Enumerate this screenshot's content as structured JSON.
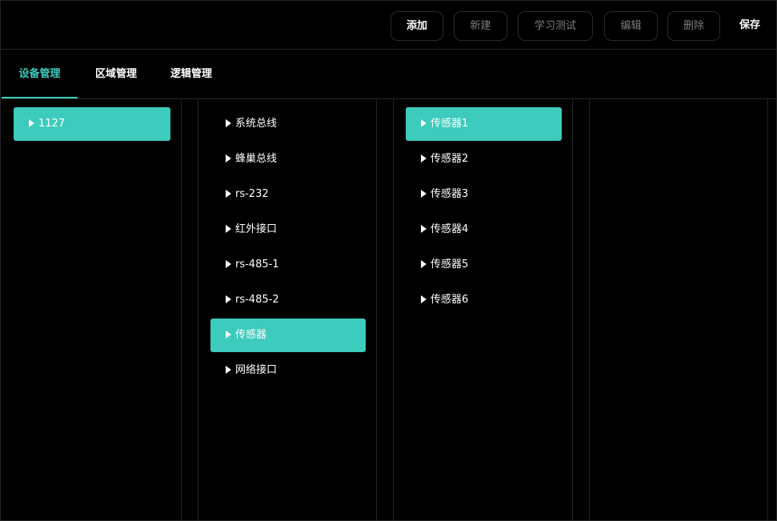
{
  "toolbar": {
    "add": "添加",
    "new": "新建",
    "learn_test": "学习测试",
    "edit": "编辑",
    "delete": "删除",
    "save": "保存"
  },
  "tabs": [
    {
      "label": "设备管理",
      "selected": true
    },
    {
      "label": "区域管理",
      "selected": false
    },
    {
      "label": "逻辑管理",
      "selected": false
    }
  ],
  "columns": {
    "devices": [
      {
        "label": "1127",
        "selected": true
      }
    ],
    "buses": [
      {
        "label": "系统总线",
        "selected": false
      },
      {
        "label": "蜂巢总线",
        "selected": false
      },
      {
        "label": "rs-232",
        "selected": false
      },
      {
        "label": "红外接口",
        "selected": false
      },
      {
        "label": "rs-485-1",
        "selected": false
      },
      {
        "label": "rs-485-2",
        "selected": false
      },
      {
        "label": "传感器",
        "selected": true
      },
      {
        "label": "网络接口",
        "selected": false
      }
    ],
    "sensors": [
      {
        "label": "传感器1",
        "selected": true
      },
      {
        "label": "传感器2",
        "selected": false
      },
      {
        "label": "传感器3",
        "selected": false
      },
      {
        "label": "传感器4",
        "selected": false
      },
      {
        "label": "传感器5",
        "selected": false
      },
      {
        "label": "传感器6",
        "selected": false
      }
    ]
  },
  "colors": {
    "accent": "#3ccbbd",
    "background": "#000000",
    "disabled_text": "#7d7d7d"
  },
  "icons": {
    "item_marker": "caret-right-icon"
  }
}
